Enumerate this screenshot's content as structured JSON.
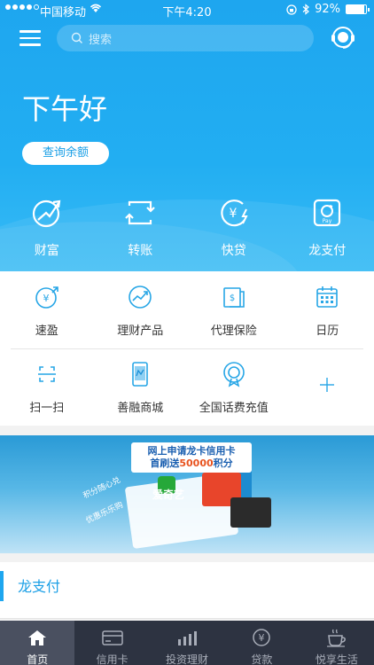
{
  "status_bar": {
    "carrier": "中国移动",
    "time": "下午4:20",
    "battery": "92%",
    "battery_level": 0.92
  },
  "header": {
    "search_placeholder": "搜索",
    "greeting": "下午好",
    "balance_button": "查询余额"
  },
  "quick_actions": [
    {
      "label": "财富",
      "icon": "wealth-icon"
    },
    {
      "label": "转账",
      "icon": "transfer-icon"
    },
    {
      "label": "快贷",
      "icon": "quick-loan-icon"
    },
    {
      "label": "龙支付",
      "icon": "long-pay-icon"
    }
  ],
  "services": {
    "row1": [
      {
        "label": "速盈",
        "icon": "suying-icon"
      },
      {
        "label": "理财产品",
        "icon": "wealth-product-icon"
      },
      {
        "label": "代理保险",
        "icon": "insurance-icon"
      },
      {
        "label": "日历",
        "icon": "calendar-icon"
      }
    ],
    "row2": [
      {
        "label": "扫一扫",
        "icon": "scan-icon"
      },
      {
        "label": "善融商城",
        "icon": "mall-icon"
      },
      {
        "label": "全国话费充值",
        "icon": "phone-recharge-icon"
      },
      {
        "label": "",
        "icon": "plus-icon"
      }
    ]
  },
  "banner": {
    "title_line1": "网上申请龙卡信用卡",
    "title_line2_prefix": "首刷送",
    "title_line2_points": "50000",
    "title_line2_suffix": "积分",
    "tag_left_1": "积分随心兑",
    "tag_left_2": "优惠乐乐购",
    "brand": "爱奇艺"
  },
  "section": {
    "title": "龙支付"
  },
  "tabs": [
    {
      "label": "首页",
      "icon": "home-icon",
      "active": true
    },
    {
      "label": "信用卡",
      "icon": "credit-card-icon",
      "active": false
    },
    {
      "label": "投资理财",
      "icon": "investment-icon",
      "active": false
    },
    {
      "label": "贷款",
      "icon": "loan-icon",
      "active": false
    },
    {
      "label": "悦享生活",
      "icon": "coffee-icon",
      "active": false
    }
  ],
  "colors": {
    "primary_blue": "#1ea6ef",
    "tabbar_bg": "#2d3341",
    "active_tab_bg": "#4a5060"
  }
}
